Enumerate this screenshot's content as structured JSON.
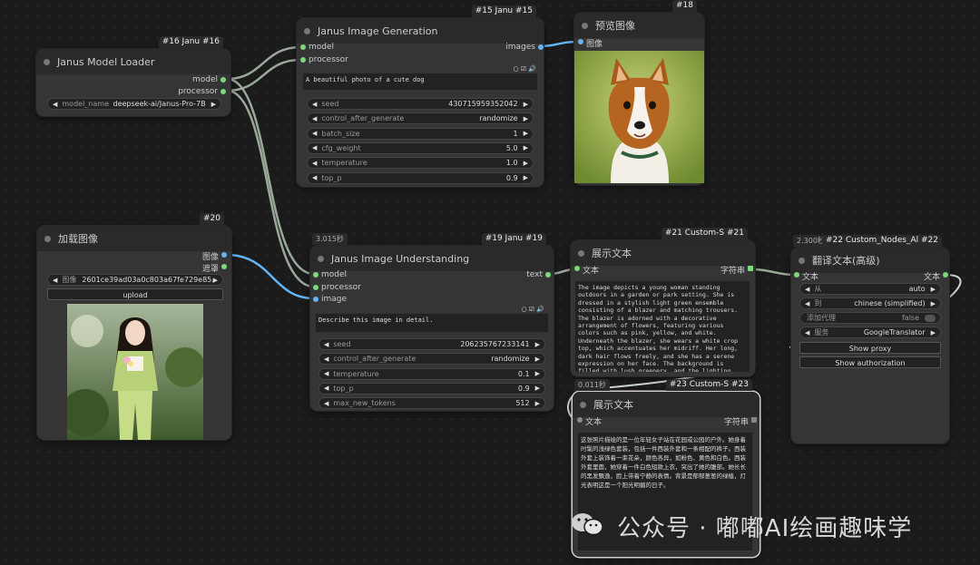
{
  "nodes": {
    "loader": {
      "badge": "#16 Janu  #16",
      "title": "Janus Model Loader",
      "outputs": [
        "model",
        "processor"
      ],
      "widget": {
        "name": "model_name",
        "value": "deepseek-ai/Janus-Pro-7B"
      }
    },
    "generation": {
      "badge": "#15 Janu  #15",
      "title": "Janus Image Generation",
      "inputs": [
        "model",
        "processor"
      ],
      "output": "images",
      "prompt": "A beautiful photo of a cute dog",
      "widgets": [
        {
          "name": "seed",
          "value": "430715959352042"
        },
        {
          "name": "control_after_generate",
          "value": "randomize"
        },
        {
          "name": "batch_size",
          "value": "1"
        },
        {
          "name": "cfg_weight",
          "value": "5.0"
        },
        {
          "name": "temperature",
          "value": "1.0"
        },
        {
          "name": "top_p",
          "value": "0.9"
        }
      ]
    },
    "preview": {
      "badge": "#18",
      "title": "预览图像",
      "input": "图像"
    },
    "load_image": {
      "badge": "#20",
      "title": "加载图像",
      "outputs": [
        "图像",
        "遮罩"
      ],
      "widget": {
        "name": "图像",
        "value": "2601ce39ad03a0c803a67fe729e85..."
      },
      "upload_label": "upload"
    },
    "understanding": {
      "timing": "3.015秒",
      "badge": "#19 Janu  #19",
      "title": "Janus Image Understanding",
      "inputs": [
        "model",
        "processor",
        "image"
      ],
      "output": "text",
      "prompt": "Describe this image in detail.",
      "widgets": [
        {
          "name": "seed",
          "value": "206235767233141"
        },
        {
          "name": "control_after_generate",
          "value": "randomize"
        },
        {
          "name": "temperature",
          "value": "0.1"
        },
        {
          "name": "top_p",
          "value": "0.9"
        },
        {
          "name": "max_new_tokens",
          "value": "512"
        }
      ]
    },
    "show_text_1": {
      "badge": "#21 Custom-S  #21",
      "title": "展示文本",
      "input": "文本",
      "output": "字符串",
      "text": "The image depicts a young woman standing outdoors in a garden or park setting. She is dressed in a stylish light green ensemble consisting of a blazer and matching trousers. The blazer is adorned with a decorative arrangement of flowers, featuring various colors such as pink, yellow, and white. Underneath the blazer, she wears a white crop top, which accentuates her midriff. Her long, dark hair flows freely, and she has a serene expression on her face. The background is filled with lush greenery, and the lighting suggests it is a sunny day."
    },
    "show_text_2": {
      "timing": "0.011秒",
      "badge": "#23 Custom-S  #23",
      "title": "展示文本",
      "input": "文本",
      "output": "字符串",
      "text": "这张照片描绘的是一位年轻女子站在花园或公园的户外。她身着时髦的浅绿色套装，包括一件西装外套和一条相配的裤子。西装外套上装饰着一束花朵，颜色各异，如粉色、黄色和白色。西装外套里面，她穿着一件白色短款上衣，突出了她的腹部。她长长的黑发飘逸，脸上带着宁静的表情。背景是郁郁葱葱的绿植，灯光表明这是一个阳光明媚的日子。"
    },
    "translate": {
      "timing": "2.300秒",
      "badge": "#22 Custom_Nodes_Al  #22",
      "title": "翻译文本(高级)",
      "input": "文本",
      "output": "文本",
      "widgets": [
        {
          "name": "从",
          "value": "auto"
        },
        {
          "name": "到",
          "value": "chinese (simplified)"
        },
        {
          "name": "添加代理",
          "value": "false"
        },
        {
          "name": "服务",
          "value": "GoogleTranslator"
        }
      ],
      "buttons": [
        "Show proxy",
        "Show authorization"
      ]
    }
  },
  "watermark": "公众号 · 嘟嘟AI绘画趣味学",
  "colors": {
    "link_model": "#9aa89a",
    "link_image": "#64b5f6",
    "link_text": "#9aa89a",
    "pin_green": "#7bd87b"
  }
}
